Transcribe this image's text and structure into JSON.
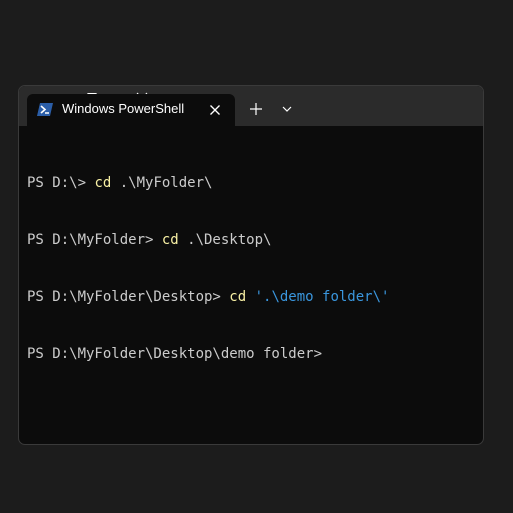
{
  "tab": {
    "title": "Windows PowerShell",
    "icon": "powershell-icon"
  },
  "titlebar": {
    "new_tab_icon": "plus-icon",
    "dropdown_icon": "chevron-down-icon",
    "minimize_icon": "minimize-icon",
    "maximize_icon": "maximize-icon",
    "close_icon": "close-icon"
  },
  "colors": {
    "background": "#0c0c0c",
    "text": "#cccccc",
    "command": "#f9f1a5",
    "string": "#3a96dd"
  },
  "terminal": {
    "lines": [
      {
        "prompt": "PS D:\\> ",
        "command": "cd",
        "args": " .\\MyFolder\\",
        "string": ""
      },
      {
        "prompt": "PS D:\\MyFolder> ",
        "command": "cd",
        "args": " .\\Desktop\\",
        "string": ""
      },
      {
        "prompt": "PS D:\\MyFolder\\Desktop> ",
        "command": "cd",
        "args": " ",
        "string": "'.\\demo folder\\'"
      },
      {
        "prompt": "PS D:\\MyFolder\\Desktop\\demo folder>",
        "command": "",
        "args": "",
        "string": ""
      }
    ]
  }
}
